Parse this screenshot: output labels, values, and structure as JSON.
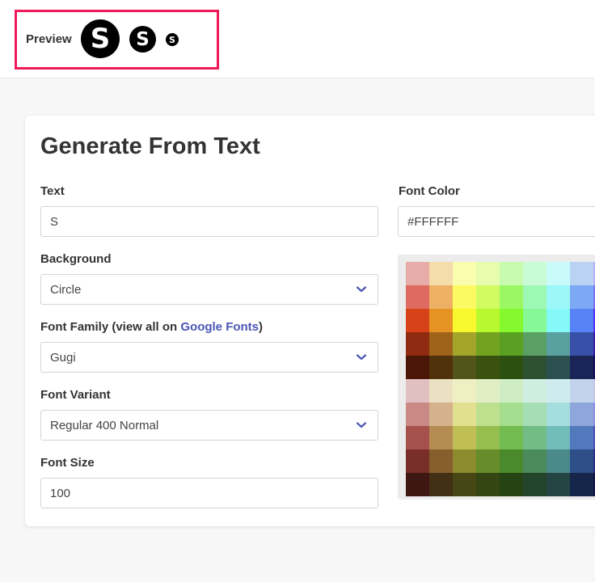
{
  "preview": {
    "label": "Preview",
    "avatar_letter": "S",
    "avatar_bg": "#000000",
    "avatar_fg": "#FFFFFF"
  },
  "form": {
    "title": "Generate From Text",
    "text_label": "Text",
    "text_value": "S",
    "background_label": "Background",
    "background_value": "Circle",
    "font_family_label_prefix": "Font Family (view all on ",
    "font_family_link": "Google Fonts",
    "font_family_label_suffix": ")",
    "font_family_value": "Gugi",
    "font_variant_label": "Font Variant",
    "font_variant_value": "Regular 400 Normal",
    "font_size_label": "Font Size",
    "font_size_value": "100",
    "font_color_label": "Font Color",
    "font_color_value": "#FFFFFF"
  },
  "palette": [
    [
      "#e8aca8",
      "#f5dcaa",
      "#fbfdae",
      "#e8fcae",
      "#c9fbaf",
      "#c9fbd7",
      "#c9fbfb",
      "#bad3f5",
      "#bab1f5"
    ],
    [
      "#df6b60",
      "#edb065",
      "#fbfa62",
      "#d2fb62",
      "#9cf862",
      "#9cf8b2",
      "#9cf8f8",
      "#7da9f4",
      "#7c71f4"
    ],
    [
      "#d84218",
      "#e79324",
      "#f8f82e",
      "#b8f82e",
      "#86f82e",
      "#86f895",
      "#86f8f8",
      "#5783f7",
      "#5a2ff7"
    ],
    [
      "#8e2b10",
      "#9e6218",
      "#a3a42a",
      "#73a221",
      "#5aa022",
      "#5aa064",
      "#5aa0a0",
      "#3850a8",
      "#3a1ca8"
    ],
    [
      "#4b1608",
      "#4f310b",
      "#53541a",
      "#3a520f",
      "#2c500f",
      "#2c5031",
      "#2c5050",
      "#1a2456",
      "#1a0e56"
    ],
    [
      "#e0c0c0",
      "#ebe0c2",
      "#efefc4",
      "#e1eec3",
      "#cfedc5",
      "#cfede1",
      "#cfebed",
      "#c3d3ec",
      "#c5c3ec"
    ],
    [
      "#c98a86",
      "#d6b18e",
      "#e0e08f",
      "#bee08e",
      "#a5de8e",
      "#a5deb4",
      "#a5dede",
      "#8ea6dc",
      "#908edc"
    ],
    [
      "#a7514d",
      "#b58c52",
      "#bfbf55",
      "#96be4f",
      "#72bc51",
      "#72bc86",
      "#72bcbc",
      "#5279bb",
      "#5451bb"
    ],
    [
      "#7a2e2a",
      "#875f2d",
      "#8c8c2f",
      "#678c2a",
      "#4a8a2c",
      "#4a8a5b",
      "#4a8a8a",
      "#2e4f88",
      "#302c88"
    ],
    [
      "#3e1712",
      "#432f14",
      "#474716",
      "#344612",
      "#254413",
      "#25442c",
      "#254444",
      "#15264a",
      "#16144a"
    ]
  ]
}
